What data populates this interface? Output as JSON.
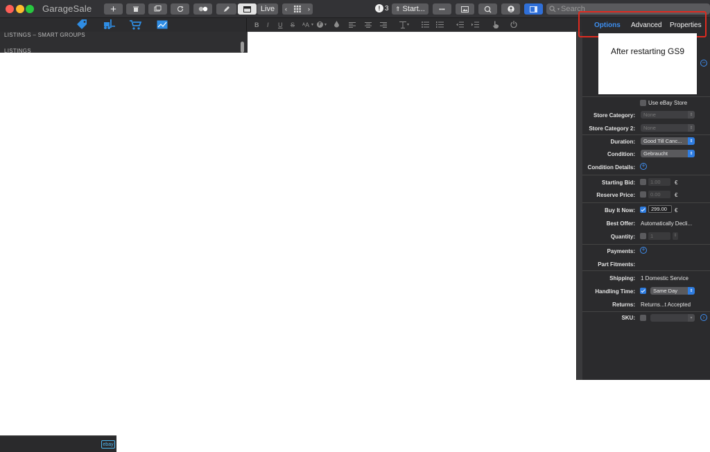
{
  "window": {
    "app_title": "GarageSale",
    "traffic_light_colors": [
      "#fe5f57",
      "#febc2e",
      "#28c840"
    ]
  },
  "toolbar": {
    "add_label": "+",
    "live_label": "Live",
    "alert_count": "3",
    "start_label": "Start...",
    "more_label": "•••",
    "search_placeholder": "Search"
  },
  "left_panel": {
    "smart_groups_header": "LISTINGS – SMART GROUPS",
    "listings_header": "LISTINGS",
    "tool_icons": [
      "tag-icon",
      "forklift-icon",
      "cart-icon",
      "chart-icon"
    ]
  },
  "format_bar": {
    "bold": "B",
    "italic": "I",
    "underline": "U",
    "strike": "S",
    "font_size": "ᴬA",
    "font": "F"
  },
  "bottom_bar": {
    "ebay_label": "ebay"
  },
  "inspector": {
    "tabs": [
      {
        "label": "Options",
        "active": true
      },
      {
        "label": "Advanced",
        "active": false
      },
      {
        "label": "Properties",
        "active": false
      }
    ],
    "preview_text": "After restarting GS9",
    "use_ebay_store_label": "Use eBay Store",
    "store_category_label": "Store Category:",
    "store_category_value": "None",
    "store_category2_label": "Store Category 2:",
    "store_category2_value": "None",
    "duration_label": "Duration:",
    "duration_value": "Good Till Canc...",
    "condition_label": "Condition:",
    "condition_value": "Gebraucht",
    "condition_details_label": "Condition Details:",
    "starting_bid_label": "Starting Bid:",
    "starting_bid_value": "1.00",
    "reserve_price_label": "Reserve Price:",
    "reserve_price_value": "0.00",
    "buy_it_now_label": "Buy It Now:",
    "buy_it_now_value": "299.00",
    "currency": "€",
    "best_offer_label": "Best Offer:",
    "best_offer_value": "Automatically Decli...",
    "quantity_label": "Quantity:",
    "quantity_value": "1",
    "payments_label": "Payments:",
    "part_fitments_label": "Part Fitments:",
    "shipping_label": "Shipping:",
    "shipping_value": "1 Domestic Service",
    "handling_time_label": "Handling Time:",
    "handling_time_value": "Same Day",
    "returns_label": "Returns:",
    "returns_value": "Returns...t Accepted",
    "sku_label": "SKU:",
    "accent_color": "#2f7de1",
    "highlight_color": "#e02b20"
  }
}
